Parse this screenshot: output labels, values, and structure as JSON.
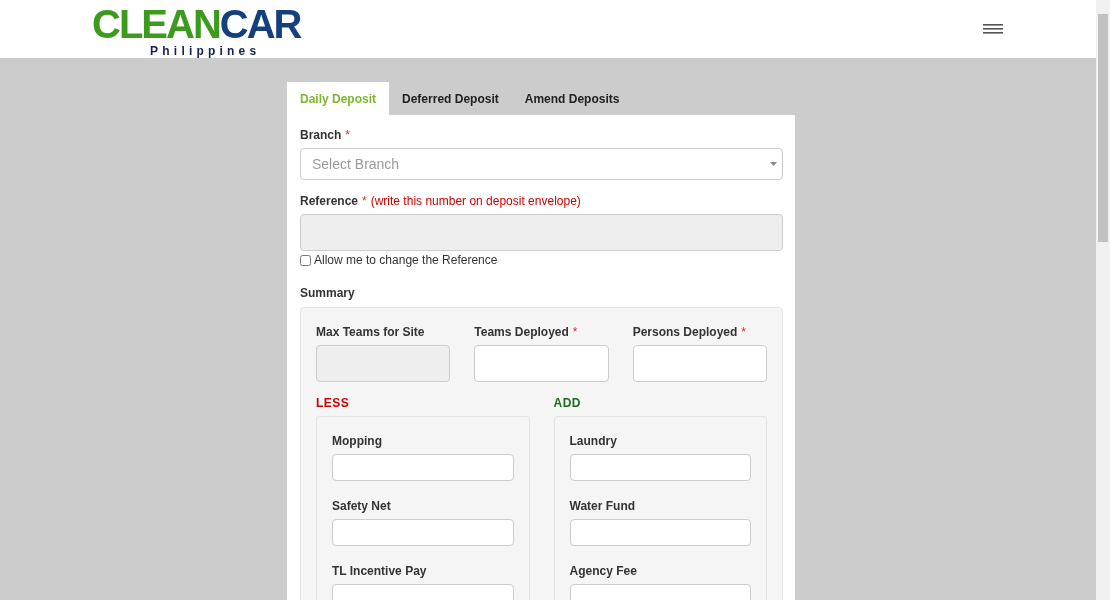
{
  "header": {
    "logo": {
      "word_1": "CLEAN",
      "word_2": "CAR",
      "tagline": "Philippines"
    }
  },
  "tabs": [
    {
      "label": "Daily Deposit",
      "selected": true
    },
    {
      "label": "Deferred Deposit",
      "selected": false
    },
    {
      "label": "Amend Deposits",
      "selected": false
    }
  ],
  "branch": {
    "label": "Branch",
    "marker": "*",
    "placeholder": "Select Branch"
  },
  "reference": {
    "label": "Reference",
    "marker": "*",
    "note": "(write this number on deposit envelope)",
    "disabled": true
  },
  "allow_change": {
    "label": "Allow me to change the Reference",
    "checked": false
  },
  "summary": {
    "title": "Summary",
    "fields": [
      {
        "label": "Max Teams for Site",
        "disabled": true
      },
      {
        "label": "Teams Deployed",
        "marker": "*",
        "disabled": false
      },
      {
        "label": "Persons Deployed",
        "marker": "*",
        "disabled": false
      }
    ],
    "groups": [
      {
        "title": "LESS",
        "kind": "less",
        "fields": [
          {
            "label": "Mopping"
          },
          {
            "label": "Safety Net"
          },
          {
            "label": "TL Incentive Pay"
          }
        ]
      },
      {
        "title": "ADD",
        "kind": "add",
        "fields": [
          {
            "label": "Laundry"
          },
          {
            "label": "Water Fund"
          },
          {
            "label": "Agency Fee"
          }
        ]
      }
    ]
  }
}
